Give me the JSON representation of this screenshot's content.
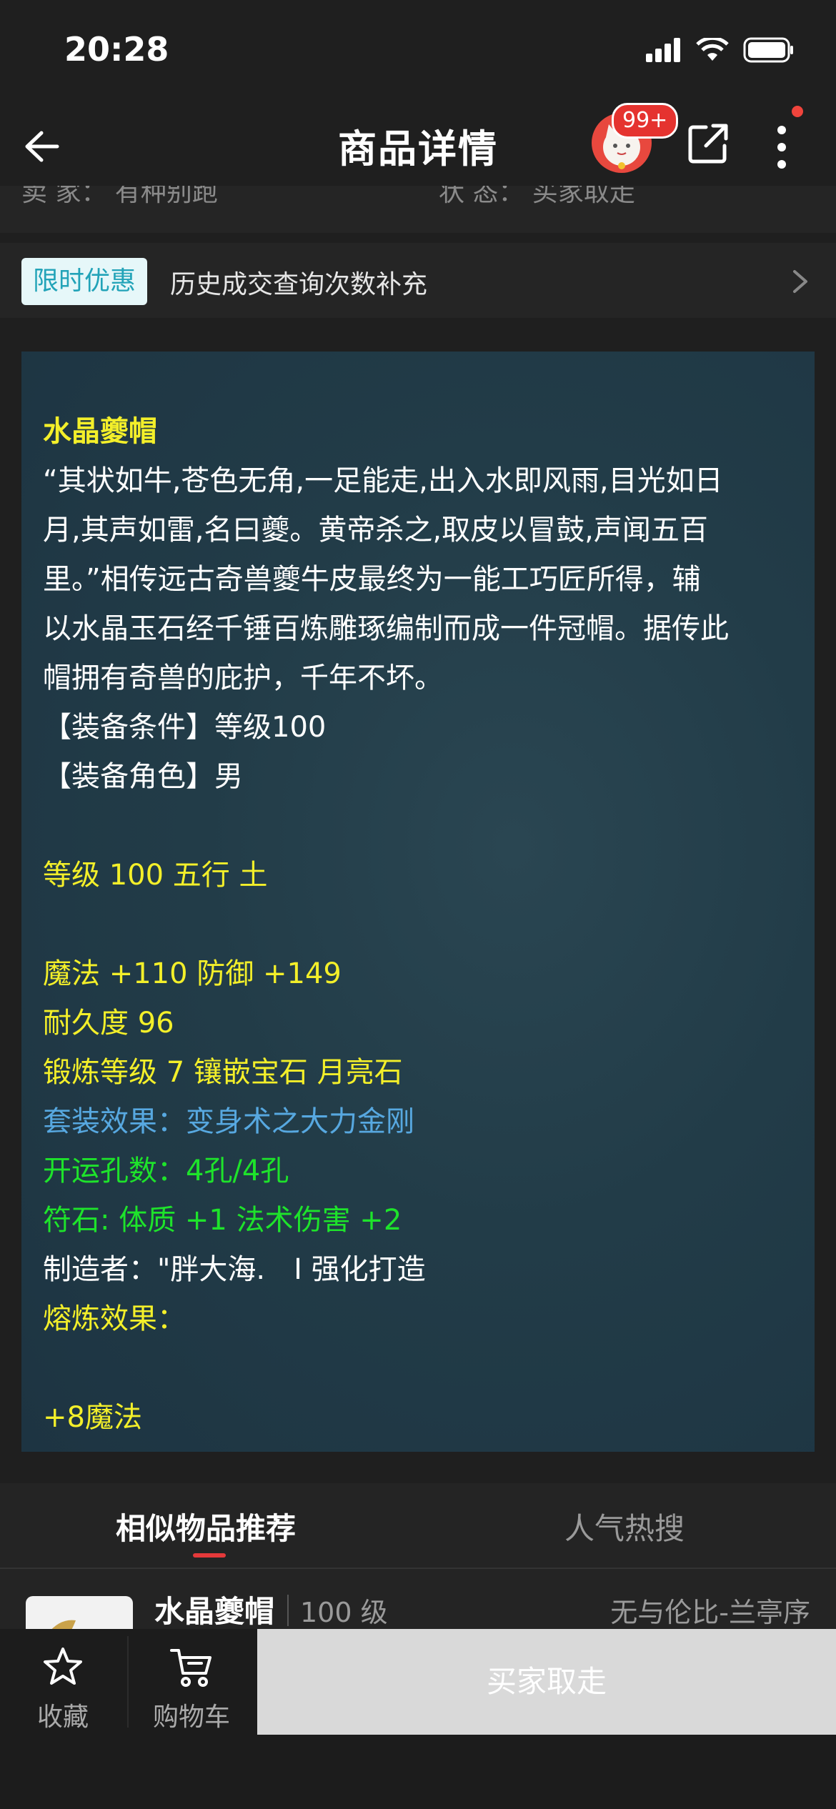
{
  "status_bar": {
    "time": "20:28"
  },
  "nav": {
    "title": "商品详情",
    "badge": "99+"
  },
  "seller_strip": {
    "left": "卖 家： 有种别跑",
    "right": "状 态： 买家取走"
  },
  "promo": {
    "tag": "限时优惠",
    "text": "历史成交查询次数补充"
  },
  "description": {
    "lines": [
      "水晶夔帽",
      "“其状如牛,苍色无角,一足能走,出入水即风雨,目光如日",
      "月,其声如雷,名曰夔。黄帝杀之,取皮以冒鼓,声闻五百",
      "里。”相传远古奇兽夔牛皮最终为一能工巧匠所得，辅",
      "以水晶玉石经千锤百炼雕琢编制而成一件冠帽。据传此",
      "帽拥有奇兽的庇护，千年不坏。",
      "【装备条件】等级100",
      "【装备角色】男",
      "",
      "等级 100 五行 土",
      "",
      "魔法 +110 防御 +149",
      "耐久度 96",
      "锻炼等级 7 镶嵌宝石 月亮石",
      "套装效果：变身术之大力金刚",
      "开运孔数：4孔/4孔",
      "符石: 体质 +1 法术伤害 +2",
      "制造者：\"胖大海.　I 强化打造",
      "熔炼效果：",
      "",
      "+8魔法"
    ]
  },
  "similar": {
    "tabs": [
      "相似物品推荐",
      "人气热搜"
    ],
    "item": {
      "name": "水晶夔帽",
      "level": "100 级",
      "server": "无与伦比-兰亭序"
    }
  },
  "bottom_bar": {
    "favorite": "收藏",
    "cart": "购物车",
    "buy": "买家取走"
  }
}
